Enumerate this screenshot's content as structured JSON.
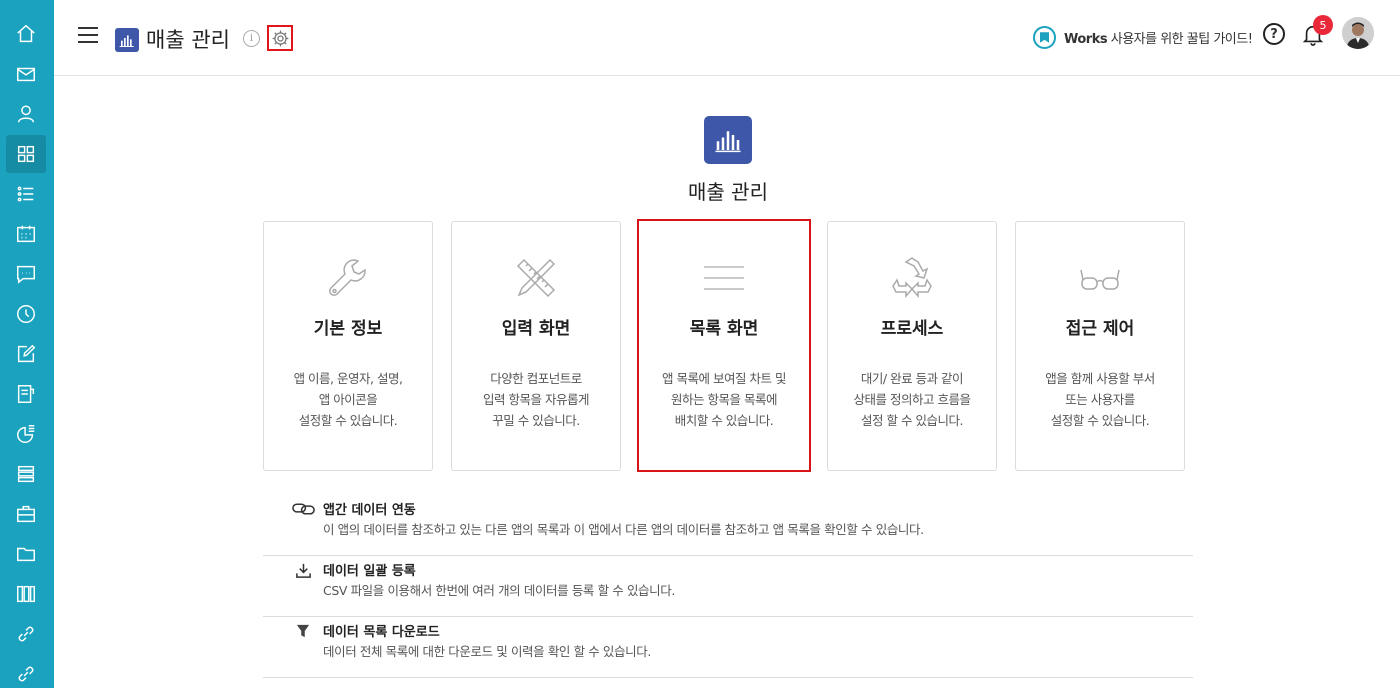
{
  "header": {
    "app_title": "매출 관리",
    "guide_brand": "Works",
    "guide_text": " 사용자를 위한 꿀팁 가이드!",
    "notification_count": "5"
  },
  "sidebar": {
    "items": [
      "home-icon",
      "mail-icon",
      "person-icon",
      "apps-grid-icon",
      "task-list-icon",
      "calendar-icon",
      "chat-icon",
      "clock-icon",
      "edit-icon",
      "document-icon",
      "report-icon",
      "database-icon",
      "briefcase-icon",
      "folder-icon",
      "library-icon",
      "link-icon",
      "link-icon"
    ],
    "active_index": 3
  },
  "main": {
    "app_name": "매출 관리",
    "cards": [
      {
        "icon": "wrench-icon",
        "title": "기본 정보",
        "desc": "앱 이름, 운영자, 설명,\n앱 아이콘을\n설정할 수 있습니다."
      },
      {
        "icon": "ruler-pencil-icon",
        "title": "입력 화면",
        "desc": "다양한 컴포넌트로\n입력 항목을 자유롭게\n꾸밀 수 있습니다."
      },
      {
        "icon": "lines-icon",
        "title": "목록 화면",
        "desc": "앱 목록에 보여질 차트 및\n원하는 항목을 목록에\n배치할 수 있습니다."
      },
      {
        "icon": "recycle-icon",
        "title": "프로세스",
        "desc": "대기/ 완료 등과 같이\n상태를 정의하고 흐름을\n설정 할 수 있습니다."
      },
      {
        "icon": "glasses-icon",
        "title": "접근 제어",
        "desc": "앱을 함께 사용할 부서\n또는 사용자를\n설정할 수 있습니다."
      }
    ],
    "selected_card": 2,
    "features": [
      {
        "icon": "chain-link-icon",
        "title": "앱간 데이터 연동",
        "desc": "이 앱의 데이터를 참조하고 있는 다른 앱의 목록과 이 앱에서 다른 앱의 데이터를 참조하고 앱 목록을 확인할 수 있습니다."
      },
      {
        "icon": "download-tray-icon",
        "title": "데이터 일괄 등록",
        "desc": "CSV 파일을 이용해서 한번에 여러 개의 데이터를 등록 할 수 있습니다."
      },
      {
        "icon": "filter-icon",
        "title": "데이터 목록 다운로드",
        "desc": "데이터 전체 목록에 대한 다운로드 및 이력을 확인 할 수 있습니다."
      }
    ]
  },
  "colors": {
    "sidebar": "#1aa2bf",
    "app_icon": "#3f57a8",
    "highlight": "#d7141a",
    "badge": "#e9283a"
  }
}
